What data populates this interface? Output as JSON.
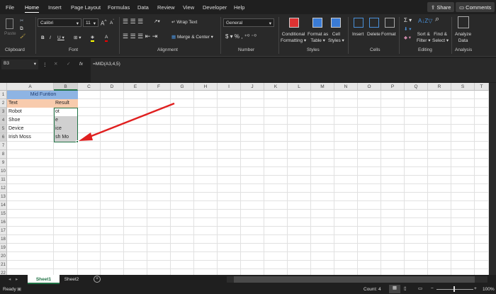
{
  "ribbon_tabs": [
    "File",
    "Home",
    "Insert",
    "Page Layout",
    "Formulas",
    "Data",
    "Review",
    "View",
    "Developer",
    "Help"
  ],
  "active_tab": "Home",
  "share_label": "Share",
  "comments_label": "Comments",
  "clipboard": {
    "paste": "Paste",
    "group": "Clipboard"
  },
  "font": {
    "name": "Calibri",
    "size": "11",
    "group": "Font"
  },
  "alignment": {
    "wrap": "Wrap Text",
    "merge": "Merge & Center",
    "group": "Alignment"
  },
  "number": {
    "format": "General",
    "group": "Number",
    "currency": "$",
    "percent": "%",
    "comma": ","
  },
  "styles": {
    "conditional": [
      "Conditional",
      "Formatting ▾"
    ],
    "table": [
      "Format as",
      "Table ▾"
    ],
    "cell": [
      "Cell",
      "Styles ▾"
    ],
    "group": "Styles"
  },
  "cells": {
    "insert": "Insert",
    "delete": "Delete",
    "format": "Format",
    "group": "Cells"
  },
  "editing": {
    "sort": [
      "Sort &",
      "Filter ▾"
    ],
    "find": [
      "Find &",
      "Select ▾"
    ],
    "group": "Editing"
  },
  "analysis": {
    "analyze": [
      "Analyze",
      "Data"
    ],
    "group": "Analysis"
  },
  "formula_bar": {
    "name_box": "B3",
    "formula": "=MID(A3,4,5)",
    "fx": "fx"
  },
  "columns": [
    "A",
    "B",
    "C",
    "D",
    "E",
    "F",
    "G",
    "H",
    "I",
    "J",
    "K",
    "L",
    "M",
    "N",
    "O",
    "P",
    "Q",
    "R",
    "S",
    "T"
  ],
  "rows": [
    "1",
    "2",
    "3",
    "4",
    "5",
    "6",
    "7",
    "8",
    "9",
    "10",
    "11",
    "12",
    "13",
    "14",
    "15",
    "16",
    "17",
    "18",
    "19",
    "20",
    "21",
    "22"
  ],
  "sheet": {
    "title": "Mid Funtion",
    "headers": [
      "Text",
      "Result"
    ],
    "data": [
      [
        "Robot",
        "ot"
      ],
      [
        "Shoe",
        "e"
      ],
      [
        "Device",
        "ice"
      ],
      [
        "Irish Moss",
        "sh Mo"
      ]
    ]
  },
  "colors": {
    "title_fill": "#8eb4e3",
    "header_fill": "#f8cbad",
    "selection": "#d0d0d0",
    "accent": "#217346",
    "arrow": "#e02020"
  },
  "sheet_tabs": [
    "Sheet1",
    "Sheet2"
  ],
  "active_sheet": "Sheet1",
  "status": {
    "ready": "Ready",
    "count": "Count: 4",
    "zoom": "100%"
  }
}
